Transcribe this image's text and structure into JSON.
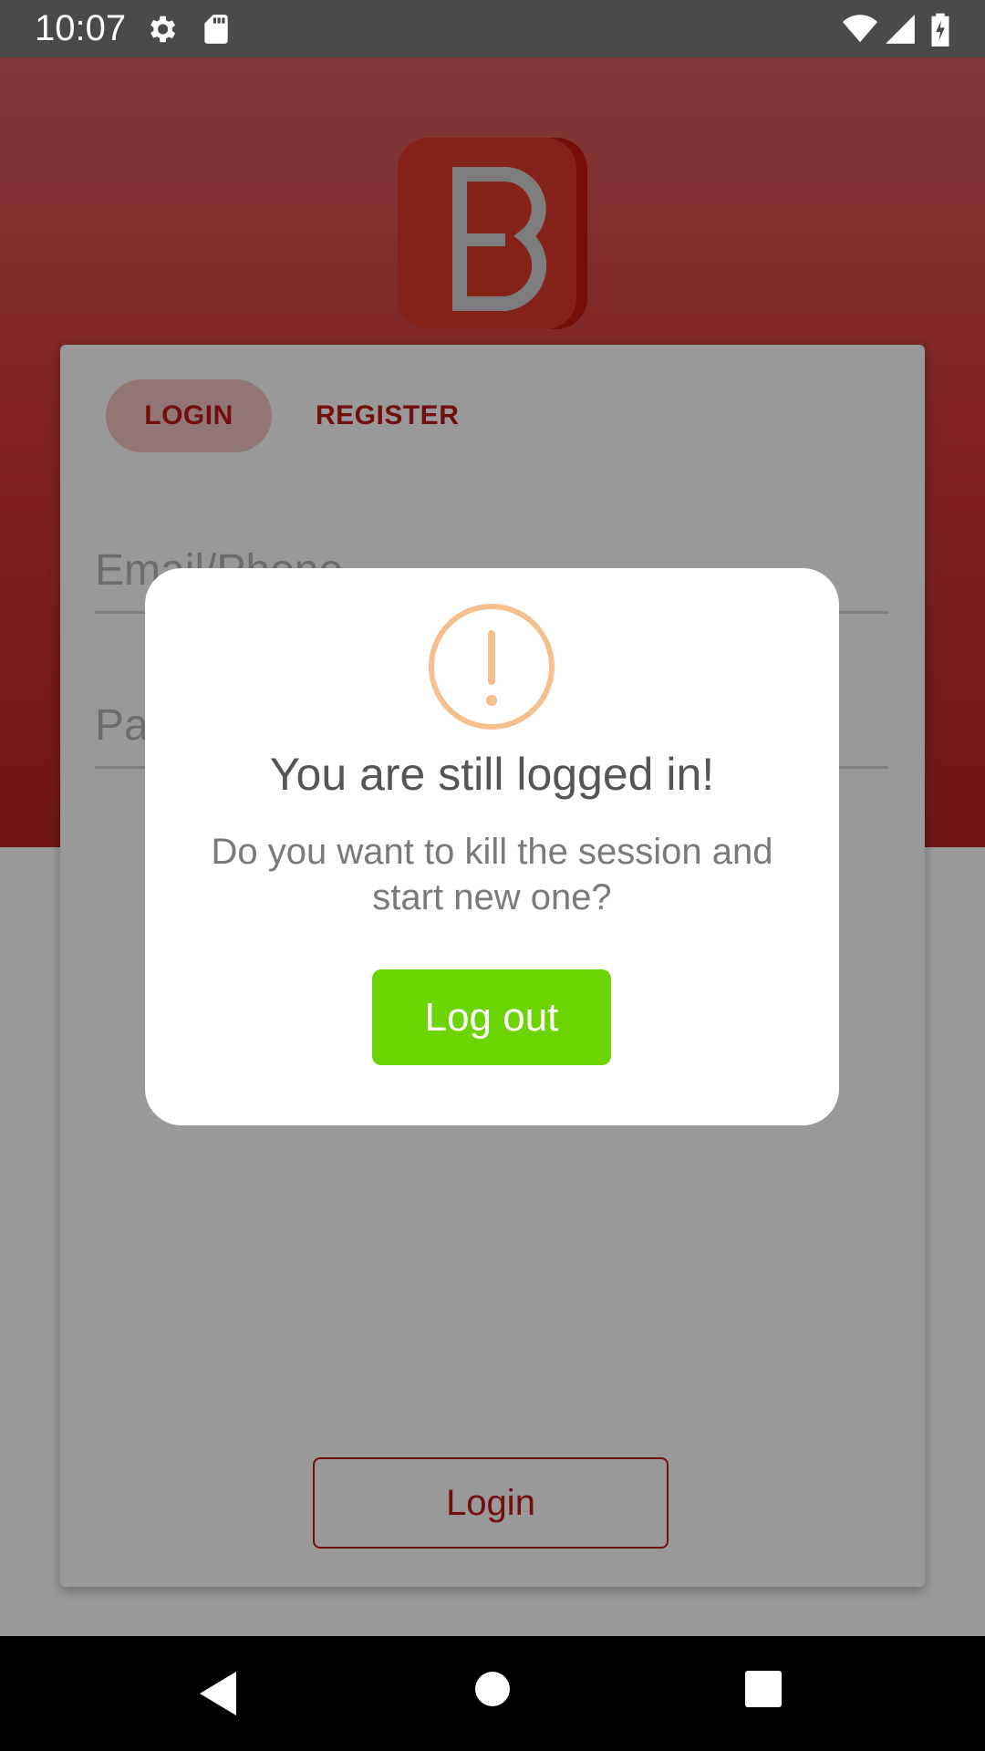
{
  "status_bar": {
    "time": "10:07",
    "icons": [
      "settings-icon",
      "sd-card-icon",
      "wifi-icon",
      "signal-icon",
      "battery-icon"
    ]
  },
  "app": {
    "brand_color": "#c01818",
    "tabs": [
      {
        "label": "LOGIN",
        "selected": true
      },
      {
        "label": "REGISTER",
        "selected": false
      }
    ],
    "email_placeholder": "Email/Phone",
    "password_placeholder": "Password",
    "login_button": "Login"
  },
  "dialog": {
    "icon": "warning-icon",
    "title": "You are still logged in!",
    "message": "Do you want to kill the session and start new one?",
    "button_label": "Log out",
    "button_color": "#6dd404"
  },
  "nav_bar": {
    "icons": [
      "back-icon",
      "home-icon",
      "recents-icon"
    ]
  }
}
